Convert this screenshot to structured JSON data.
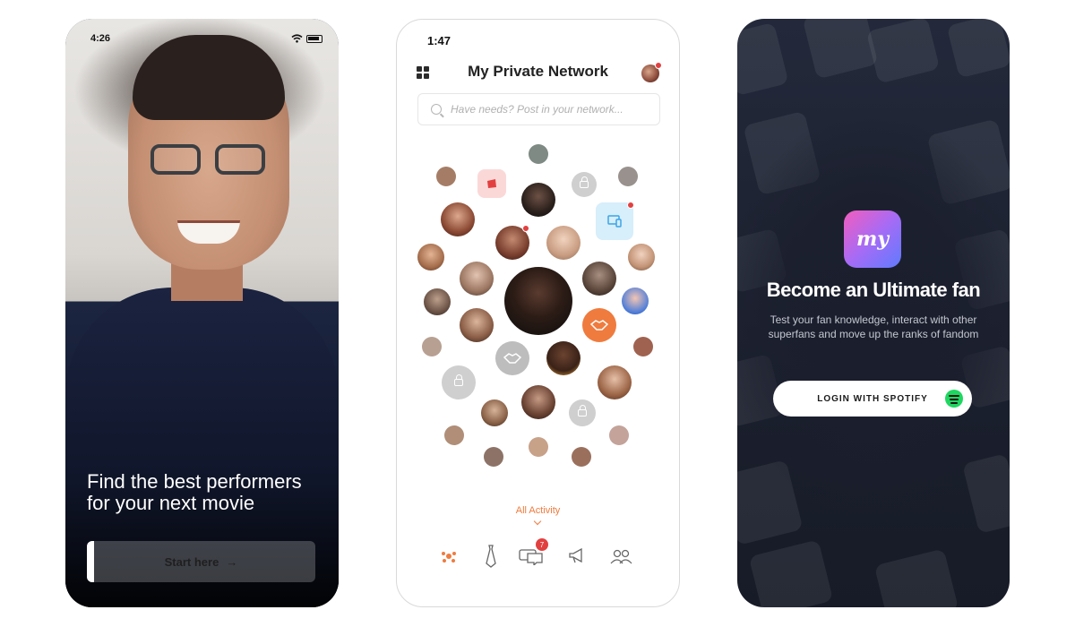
{
  "screen1": {
    "status_time": "4:26",
    "headline_line1": "Find the best performers",
    "headline_line2": "for your next movie",
    "cta_label": "Start here",
    "cta_arrow": "→"
  },
  "screen2": {
    "status_time": "1:47",
    "title": "My Private Network",
    "search_placeholder": "Have needs? Post in your network...",
    "all_activity_label": "All Activity",
    "messages_badge": "7",
    "accent_color": "#ef7b3e",
    "alert_color": "#e24040"
  },
  "screen3": {
    "logo_text": "my",
    "title": "Become an Ultimate fan",
    "subtitle": "Test your fan knowledge, interact with other superfans and move up the ranks of fandom",
    "login_label": "LOGIN WITH SPOTIFY",
    "spotify_color": "#1ed760"
  }
}
